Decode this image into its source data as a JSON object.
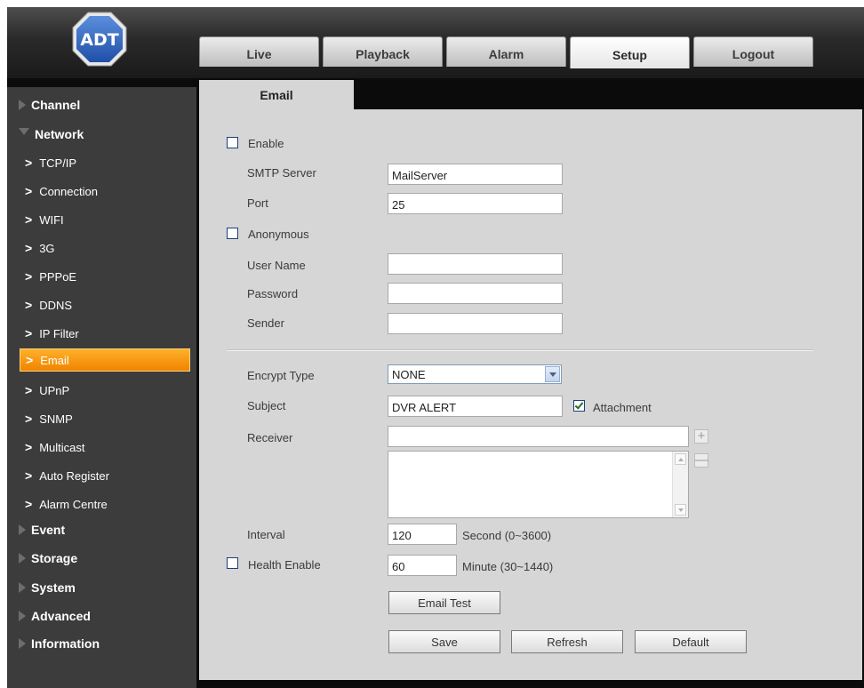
{
  "logo": {
    "text": "ADT"
  },
  "nav_tabs": [
    {
      "label": "Live"
    },
    {
      "label": "Playback"
    },
    {
      "label": "Alarm"
    },
    {
      "label": "Setup",
      "active": true
    },
    {
      "label": "Logout"
    }
  ],
  "sidebar": {
    "categories": {
      "channel": "Channel",
      "network": "Network",
      "event": "Event",
      "storage": "Storage",
      "system": "System",
      "advanced": "Advanced",
      "information": "Information"
    },
    "network_items": [
      {
        "label": "TCP/IP"
      },
      {
        "label": "Connection"
      },
      {
        "label": "WIFI"
      },
      {
        "label": "3G"
      },
      {
        "label": "PPPoE"
      },
      {
        "label": "DDNS"
      },
      {
        "label": "IP Filter"
      },
      {
        "label": "Email",
        "active": true
      },
      {
        "label": "UPnP"
      },
      {
        "label": "SNMP"
      },
      {
        "label": "Multicast"
      },
      {
        "label": "Auto Register"
      },
      {
        "label": "Alarm Centre"
      }
    ]
  },
  "page": {
    "tab_title": "Email",
    "enable": {
      "label": "Enable",
      "checked": false
    },
    "smtp_server": {
      "label": "SMTP Server",
      "value": "MailServer"
    },
    "port": {
      "label": "Port",
      "value": "25"
    },
    "anonymous": {
      "label": "Anonymous",
      "checked": false
    },
    "user_name": {
      "label": "User Name",
      "value": ""
    },
    "password": {
      "label": "Password",
      "value": ""
    },
    "sender": {
      "label": "Sender",
      "value": ""
    },
    "encrypt_type": {
      "label": "Encrypt Type",
      "value": "NONE"
    },
    "subject": {
      "label": "Subject",
      "value": "DVR ALERT"
    },
    "attachment": {
      "label": "Attachment",
      "checked": true
    },
    "receiver": {
      "label": "Receiver",
      "value": "",
      "add_icon": "+",
      "remove_icon": "—"
    },
    "interval": {
      "label": "Interval",
      "value": "120",
      "unit": "Second (0~3600)"
    },
    "health_enable": {
      "label": "Health Enable",
      "checked": false,
      "value": "60",
      "unit": "Minute (30~1440)"
    },
    "buttons": {
      "email_test": "Email Test",
      "save": "Save",
      "refresh": "Refresh",
      "default": "Default"
    }
  }
}
